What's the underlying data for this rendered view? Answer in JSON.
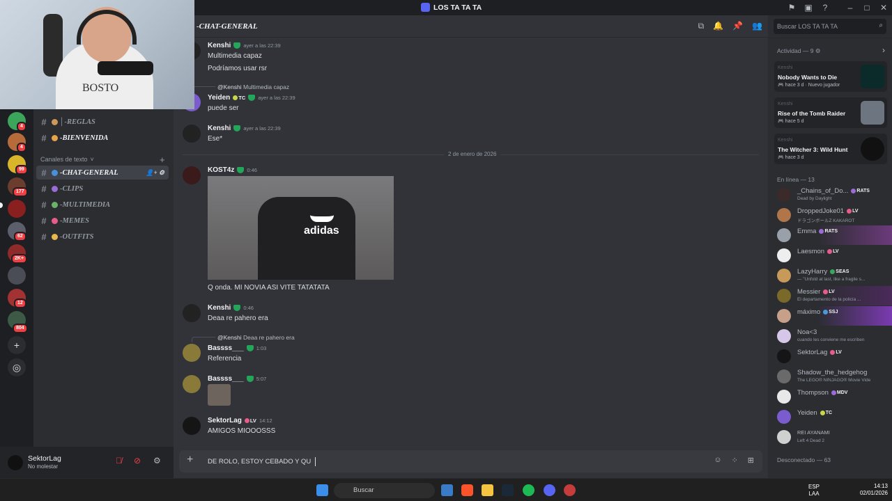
{
  "window": {
    "title": "LOS TA TA TA"
  },
  "webcam": {
    "shirt_text": "BOSTO"
  },
  "servers": {
    "badges": [
      "4",
      "4",
      "99",
      "177",
      "62",
      "2K+",
      "12",
      "804"
    ]
  },
  "channels": {
    "top": [
      {
        "name": "│-REGLAS"
      },
      {
        "name": "-BIENVENIDA"
      }
    ],
    "category": "Canales de texto",
    "text": [
      {
        "name": "-CHAT-GENERAL",
        "active": true
      },
      {
        "name": "-CLIPS"
      },
      {
        "name": "-MULTIMEDIA"
      },
      {
        "name": "-MEMES"
      },
      {
        "name": "-OUTFITS"
      }
    ]
  },
  "user_panel": {
    "name": "SektorLag",
    "status": "No molestar"
  },
  "header": {
    "channel": "-CHAT-GENERAL"
  },
  "messages": [
    {
      "author": "Kenshi",
      "time": "ayer a las 22:39",
      "lines": [
        "Multimedia capaz",
        "Podríamos usar rsr"
      ]
    },
    {
      "reply_to": "@Kenshi",
      "reply_text": "Multimedia capaz",
      "author": "Yeiden",
      "tag": "TC",
      "time": "ayer a las 22:39",
      "lines": [
        "puede ser"
      ]
    },
    {
      "author": "Kenshi",
      "time": "ayer a las 22:39",
      "lines": [
        "Ese*"
      ]
    },
    {
      "divider": "2 de enero de 2026"
    },
    {
      "author": "KOST4z",
      "time": "0:46",
      "image_text": "adidas",
      "lines": [
        "Q onda. MI NOVIA ASI VITE TATATATA"
      ]
    },
    {
      "author": "Kenshi",
      "time": "0:46",
      "lines": [
        "Deaa re pahero era"
      ]
    },
    {
      "reply_to": "@Kenshi",
      "reply_text": "Deaa re pahero era",
      "author": "Bassss___",
      "time": "1:03",
      "lines": [
        "Referencia"
      ]
    },
    {
      "author": "Bassss___",
      "time": "5:07",
      "lines": []
    },
    {
      "author": "SektorLag",
      "tag": "LV",
      "time": "14:12",
      "lines": [
        "AMIGOS MIOOOSSS"
      ]
    }
  ],
  "composer": {
    "value": "DE ROLO, ESTOY CEBADO Y QU"
  },
  "search": {
    "placeholder": "Buscar LOS TA TA TA"
  },
  "activity": {
    "header": "Actividad — 9",
    "cards": [
      {
        "who": "Kenshi",
        "title": "Nobody Wants to Die",
        "sub": "hace 3 d",
        "extra": "Nuevo jugador"
      },
      {
        "who": "Kenshi",
        "title": "Rise of the Tomb Raider",
        "sub": "hace 5 d",
        "extra": ""
      },
      {
        "who": "Kenshi",
        "title": "The Witcher 3: Wild Hunt",
        "sub": "hace 3 d",
        "extra": ""
      }
    ]
  },
  "online": {
    "header": "En línea — 13",
    "members": [
      {
        "name": "_Chains_of_Do...",
        "tag": "RATS",
        "sub": "Dead by Daylight"
      },
      {
        "name": "DroppedJoke01",
        "tag": "LV",
        "sub": "ドラゴンボールZ KAKAROT"
      },
      {
        "name": "Emma",
        "tag": "RATS",
        "sub": ""
      },
      {
        "name": "Laesmon",
        "tag": "LV",
        "sub": ""
      },
      {
        "name": "LazyHarry",
        "tag": "SEAS",
        "sub": "— \"Unfold at last, like a fragile s..."
      },
      {
        "name": "Messier",
        "tag": "LV",
        "sub": "El departamento de la policía ..."
      },
      {
        "name": "máximo",
        "tag": "SSJ",
        "sub": ""
      },
      {
        "name": "Noa<3",
        "tag": "",
        "sub": "cuando les conviene me escriben"
      },
      {
        "name": "SektorLag",
        "tag": "LV",
        "sub": ""
      },
      {
        "name": "Shadow_the_hedgehog",
        "tag": "",
        "sub": "The LEGO® NINJAGO® Movie Vide"
      },
      {
        "name": "Thompson",
        "tag": "MDV",
        "sub": ""
      },
      {
        "name": "Yeiden",
        "tag": "TC",
        "sub": ""
      },
      {
        "name": "REI AYANAMI",
        "tag": "",
        "sub": "Left 4 Dead 2"
      }
    ],
    "offline_header": "Desconectado — 63"
  },
  "taskbar": {
    "search": "Buscar",
    "lang1": "ESP",
    "lang2": "LAA",
    "time": "14:13",
    "date": "02/01/2026"
  },
  "colors": {
    "accent": "#5865f2",
    "online": "#23a55a",
    "dnd": "#f23f43"
  }
}
